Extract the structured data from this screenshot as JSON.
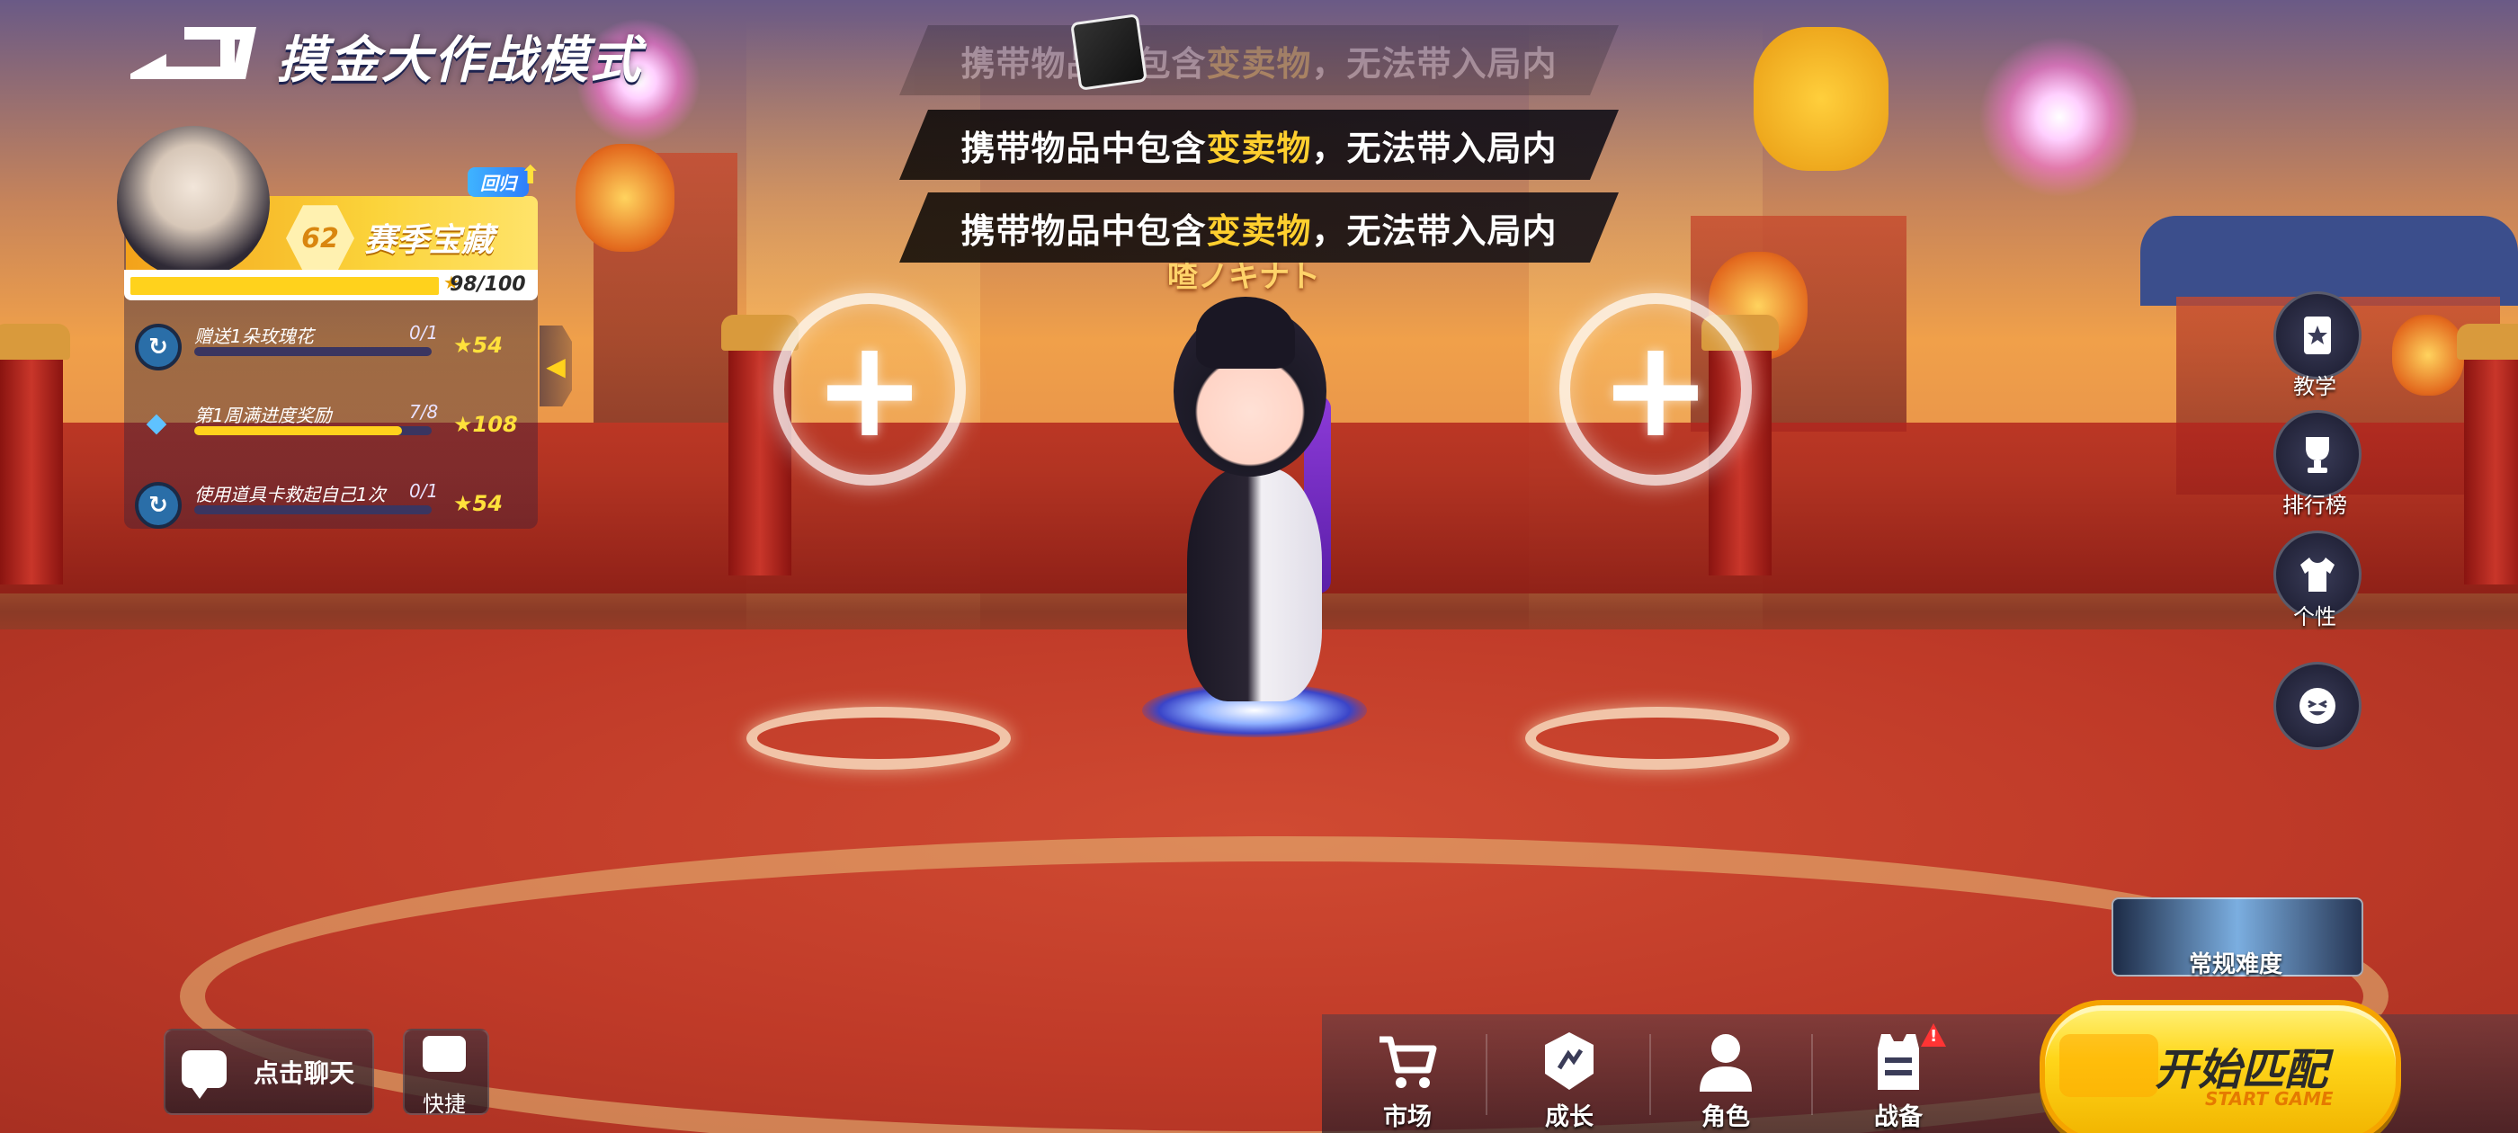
{
  "header": {
    "mode_title": "摸金大作战模式"
  },
  "season_treasure": {
    "return_tag": "回归",
    "level": "62",
    "title": "赛季宝藏",
    "progress_text": "98/100",
    "progress_value": 98,
    "progress_max": 100,
    "tasks": [
      {
        "label": "赠送1朵玫瑰花",
        "count": "0/1",
        "reward": "54",
        "progress": 0
      },
      {
        "label": "第1周满进度奖励",
        "count": "7/8",
        "reward": "108",
        "progress": 0.875
      },
      {
        "label": "使用道具卡救起自己1次",
        "count": "0/1",
        "reward": "54",
        "progress": 0
      }
    ]
  },
  "notifications": [
    {
      "prefix": "携带物品中包含",
      "highlight": "变卖物",
      "suffix": "，无法带入局内",
      "faded": true
    },
    {
      "prefix": "携带物品中包含",
      "highlight": "变卖物",
      "suffix": "，无法带入局内",
      "faded": false
    },
    {
      "prefix": "携带物品中包含",
      "highlight": "变卖物",
      "suffix": "，无法带入局内",
      "faded": false
    }
  ],
  "player_name_partial": "喳ノキナト",
  "side_menu": [
    {
      "label": "教学",
      "icon": "tutorial-book-icon"
    },
    {
      "label": "排行榜",
      "icon": "trophy-icon"
    },
    {
      "label": "个性",
      "icon": "shirt-icon"
    },
    {
      "label": "",
      "icon": "emote-icon"
    }
  ],
  "difficulty": {
    "label": "常规难度"
  },
  "bottom_nav": [
    {
      "label": "市场",
      "icon": "cart-icon"
    },
    {
      "label": "成长",
      "icon": "growth-icon"
    },
    {
      "label": "角色",
      "icon": "person-icon"
    },
    {
      "label": "战备",
      "icon": "vest-icon",
      "alert": "!"
    }
  ],
  "start_button": {
    "label": "开始匹配",
    "sub_label": "START GAME"
  },
  "chat": {
    "label": "点击聊天",
    "quick_label": "快捷"
  },
  "colors": {
    "highlight": "#ffcf2e",
    "primary_yellow": "#ffd61a",
    "accent_orange": "#f3a21a"
  }
}
